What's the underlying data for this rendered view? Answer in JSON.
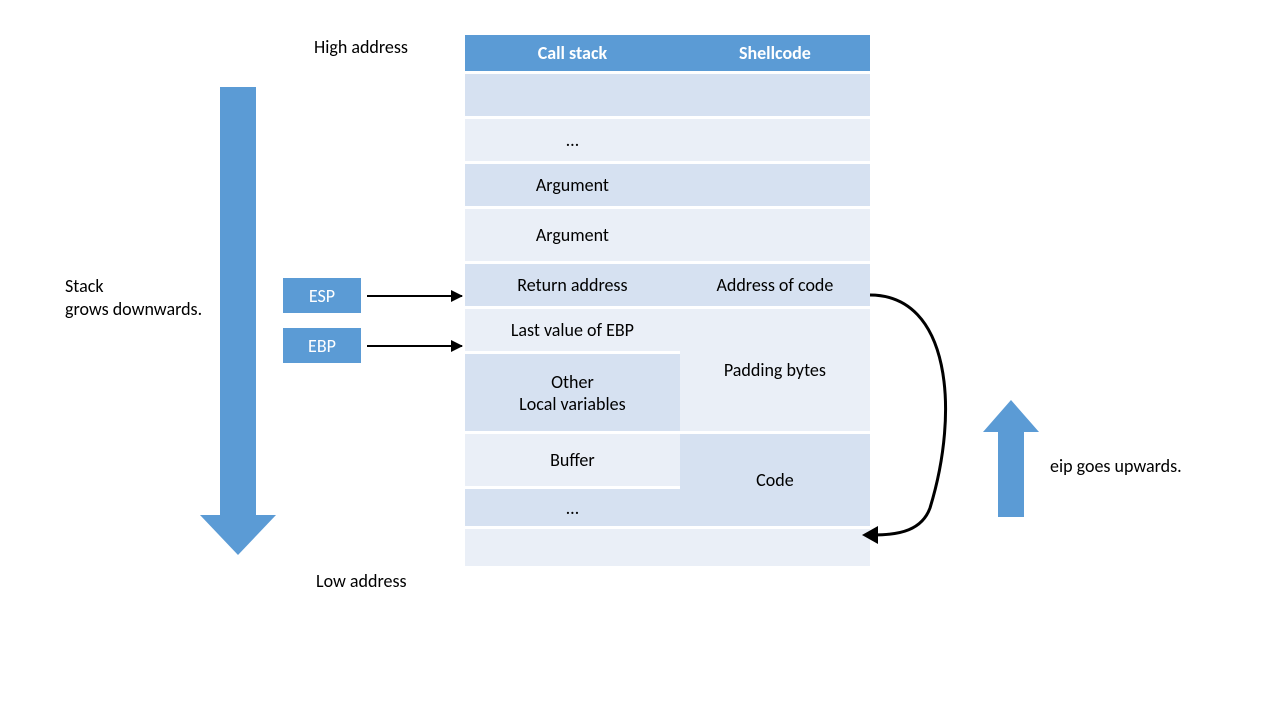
{
  "labels": {
    "high": "High address",
    "low": "Low address",
    "stackGrow1": "Stack",
    "stackGrow2": "grows downwards.",
    "eip": "eip goes upwards.",
    "esp": "ESP",
    "ebp": "EBP"
  },
  "headers": {
    "c0": "Call stack",
    "c1": "Shellcode"
  },
  "rows": {
    "r1c0": "",
    "r1c1": "",
    "r2c0": "…",
    "r2c1": "",
    "r3c0": "Argument",
    "r3c1": "",
    "r4c0": "Argument",
    "r4c1": "",
    "r5c0": "Return address",
    "r5c1": "Address of code",
    "r6c0": "Last value of EBP",
    "r7c0a": "Other",
    "r7c0b": "Local variables",
    "r7c1": "Padding bytes",
    "r8c0": "Buffer",
    "r8c1": "Code",
    "r9c0": "…",
    "r9c1": ""
  }
}
